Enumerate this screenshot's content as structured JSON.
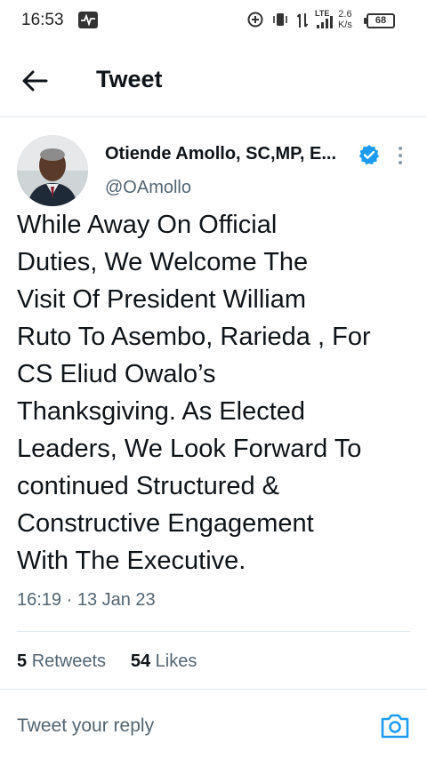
{
  "status_bar": {
    "time": "16:53",
    "network": "LTE",
    "speed_value": "2.6",
    "speed_unit": "K/s",
    "battery": "68"
  },
  "header": {
    "title": "Tweet"
  },
  "tweet": {
    "author_name": "Otiende Amollo, SC,MP, E...",
    "handle": "@OAmollo",
    "text_lines": [
      "While  Away On Official",
      "Duties, We Welcome The",
      "Visit Of President William",
      "Ruto To Asembo, Rarieda , For",
      "CS Eliud Owalo’s",
      "Thanksgiving. As Elected",
      "Leaders, We Look Forward To",
      "continued Structured &",
      "Constructive Engagement",
      "With The Executive."
    ],
    "timestamp": "16:19 · 13 Jan 23",
    "retweets_count": "5",
    "retweets_label": "Retweets",
    "likes_count": "54",
    "likes_label": "Likes"
  },
  "reply": {
    "placeholder": "Tweet your reply"
  },
  "colors": {
    "accent": "#1d9bf0",
    "text_primary": "#0f1419",
    "text_secondary": "#536471",
    "divider": "#e1e8ed"
  },
  "icons": {
    "back": "arrow-left-icon",
    "verified": "verified-badge-icon",
    "more": "more-vertical-icon",
    "camera": "camera-icon"
  }
}
